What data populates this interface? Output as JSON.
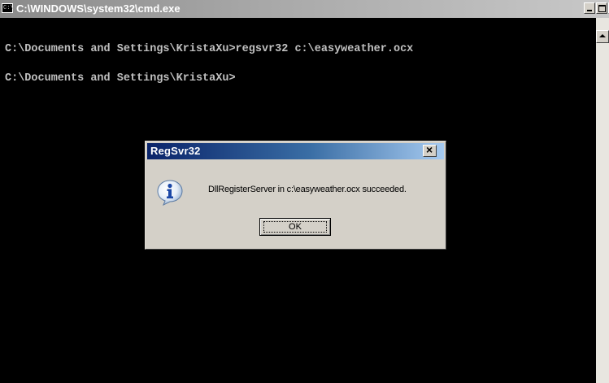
{
  "console": {
    "title": "C:\\WINDOWS\\system32\\cmd.exe",
    "lines": [
      "C:\\Documents and Settings\\KristaXu>regsvr32 c:\\easyweather.ocx",
      "C:\\Documents and Settings\\KristaXu>"
    ],
    "icon_text": "C:\\"
  },
  "dialog": {
    "title": "RegSvr32",
    "message": "DllRegisterServer in c:\\easyweather.ocx succeeded.",
    "ok_label": "OK",
    "icon": "information-icon"
  },
  "colors": {
    "console_bg": "#000000",
    "console_text": "#c0c0c0",
    "dialog_title_bar": "#0a246a",
    "dialog_face": "#d4d0c8"
  }
}
